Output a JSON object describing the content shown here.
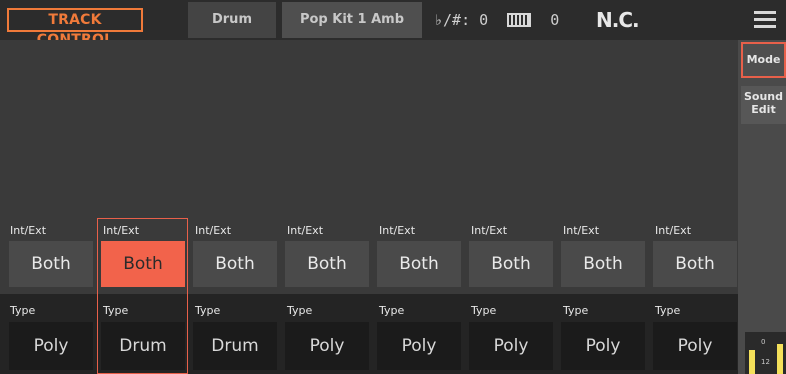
{
  "header": {
    "title": "TRACK CONTROL",
    "track_type": "Drum",
    "sound_name": "Pop Kit 1 Amb",
    "transpose_label": "♭/#:",
    "transpose_value": "0",
    "octave_value": "0",
    "chord": "N.C."
  },
  "side_buttons": {
    "mode": "Mode",
    "sound_edit_line1": "Sound",
    "sound_edit_line2": "Edit"
  },
  "tracks": [
    {
      "int_ext_label": "Int/Ext",
      "int_ext": "Both",
      "type_label": "Type",
      "type": "Poly"
    },
    {
      "int_ext_label": "Int/Ext",
      "int_ext": "Both",
      "type_label": "Type",
      "type": "Drum"
    },
    {
      "int_ext_label": "Int/Ext",
      "int_ext": "Both",
      "type_label": "Type",
      "type": "Drum"
    },
    {
      "int_ext_label": "Int/Ext",
      "int_ext": "Both",
      "type_label": "Type",
      "type": "Poly"
    },
    {
      "int_ext_label": "Int/Ext",
      "int_ext": "Both",
      "type_label": "Type",
      "type": "Poly"
    },
    {
      "int_ext_label": "Int/Ext",
      "int_ext": "Both",
      "type_label": "Type",
      "type": "Poly"
    },
    {
      "int_ext_label": "Int/Ext",
      "int_ext": "Both",
      "type_label": "Type",
      "type": "Poly"
    },
    {
      "int_ext_label": "Int/Ext",
      "int_ext": "Both",
      "type_label": "Type",
      "type": "Poly"
    }
  ],
  "selected_track_index": 1,
  "meter": {
    "level_top": "0",
    "level_bottom": "12"
  },
  "colors": {
    "accent": "#f2634b",
    "title": "#f07a3a"
  }
}
